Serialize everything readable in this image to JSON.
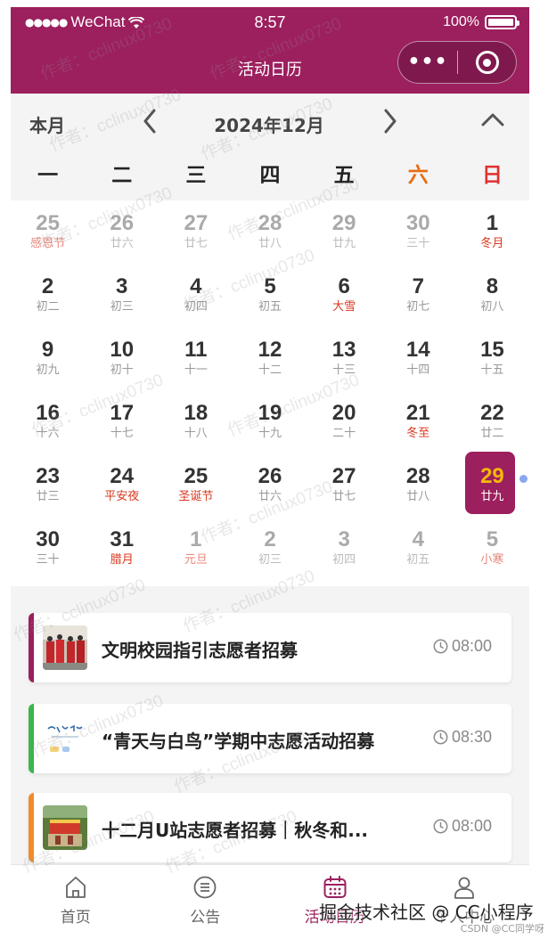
{
  "status_bar": {
    "signal_dots": "●●●●●",
    "carrier": "WeChat",
    "time": "8:57",
    "battery": "100%",
    "battery_level": 1.0
  },
  "header": {
    "title": "活动日历",
    "more_icon": "more-dots-icon",
    "close_icon": "target-circle-icon",
    "color": "#9c1f5e"
  },
  "calendar": {
    "today_label": "本月",
    "month_label": "2024年12月",
    "weekdays": [
      "一",
      "二",
      "三",
      "四",
      "五",
      "六",
      "日"
    ],
    "weekend_colors": {
      "sat": "#e86b10",
      "sun": "#e03131"
    },
    "days": [
      {
        "d": "25",
        "l": "感恩节",
        "other": true,
        "fest": true
      },
      {
        "d": "26",
        "l": "廿六",
        "other": true
      },
      {
        "d": "27",
        "l": "廿七",
        "other": true
      },
      {
        "d": "28",
        "l": "廿八",
        "other": true
      },
      {
        "d": "29",
        "l": "廿九",
        "other": true
      },
      {
        "d": "30",
        "l": "三十",
        "other": true
      },
      {
        "d": "1",
        "l": "冬月",
        "fest": true
      },
      {
        "d": "2",
        "l": "初二"
      },
      {
        "d": "3",
        "l": "初三"
      },
      {
        "d": "4",
        "l": "初四"
      },
      {
        "d": "5",
        "l": "初五"
      },
      {
        "d": "6",
        "l": "大雪",
        "fest": true
      },
      {
        "d": "7",
        "l": "初七"
      },
      {
        "d": "8",
        "l": "初八"
      },
      {
        "d": "9",
        "l": "初九"
      },
      {
        "d": "10",
        "l": "初十"
      },
      {
        "d": "11",
        "l": "十一"
      },
      {
        "d": "12",
        "l": "十二"
      },
      {
        "d": "13",
        "l": "十三"
      },
      {
        "d": "14",
        "l": "十四"
      },
      {
        "d": "15",
        "l": "十五"
      },
      {
        "d": "16",
        "l": "十六"
      },
      {
        "d": "17",
        "l": "十七"
      },
      {
        "d": "18",
        "l": "十八"
      },
      {
        "d": "19",
        "l": "十九"
      },
      {
        "d": "20",
        "l": "二十"
      },
      {
        "d": "21",
        "l": "冬至",
        "fest": true
      },
      {
        "d": "22",
        "l": "廿二"
      },
      {
        "d": "23",
        "l": "廿三"
      },
      {
        "d": "24",
        "l": "平安夜",
        "fest": true
      },
      {
        "d": "25",
        "l": "圣诞节",
        "fest": true
      },
      {
        "d": "26",
        "l": "廿六"
      },
      {
        "d": "27",
        "l": "廿七"
      },
      {
        "d": "28",
        "l": "廿八"
      },
      {
        "d": "29",
        "l": "廿九",
        "today": true
      },
      {
        "d": "30",
        "l": "三十"
      },
      {
        "d": "31",
        "l": "腊月",
        "fest": true
      },
      {
        "d": "1",
        "l": "元旦",
        "other": true,
        "fest": true
      },
      {
        "d": "2",
        "l": "初三",
        "other": true
      },
      {
        "d": "3",
        "l": "初四",
        "other": true
      },
      {
        "d": "4",
        "l": "初五",
        "other": true
      },
      {
        "d": "5",
        "l": "小寒",
        "other": true,
        "fest": true
      }
    ]
  },
  "events": [
    {
      "title": "文明校园指引志愿者招募",
      "time": "08:00",
      "color": "#9c1f5e",
      "thumb": "photo-volunteers"
    },
    {
      "title": "“青天与白鸟”学期中志愿活动招募",
      "time": "08:30",
      "color": "#3cb44b",
      "thumb": "photo-calligraphy"
    },
    {
      "title": "十二月U站志愿者招募｜秋冬和...",
      "time": "08:00",
      "color": "#f08c2a",
      "thumb": "photo-station"
    }
  ],
  "tabs": [
    {
      "label": "首页",
      "icon": "home-icon"
    },
    {
      "label": "公告",
      "icon": "notice-icon"
    },
    {
      "label": "活动日历",
      "icon": "calendar-icon",
      "active": true
    },
    {
      "label": "个人中心",
      "icon": "user-icon"
    }
  ],
  "overlay": {
    "watermark": "作者：cclinux0730",
    "brand": "掘金技术社区 @ CC小程序",
    "csdn": "CSDN @CC同学呀"
  }
}
